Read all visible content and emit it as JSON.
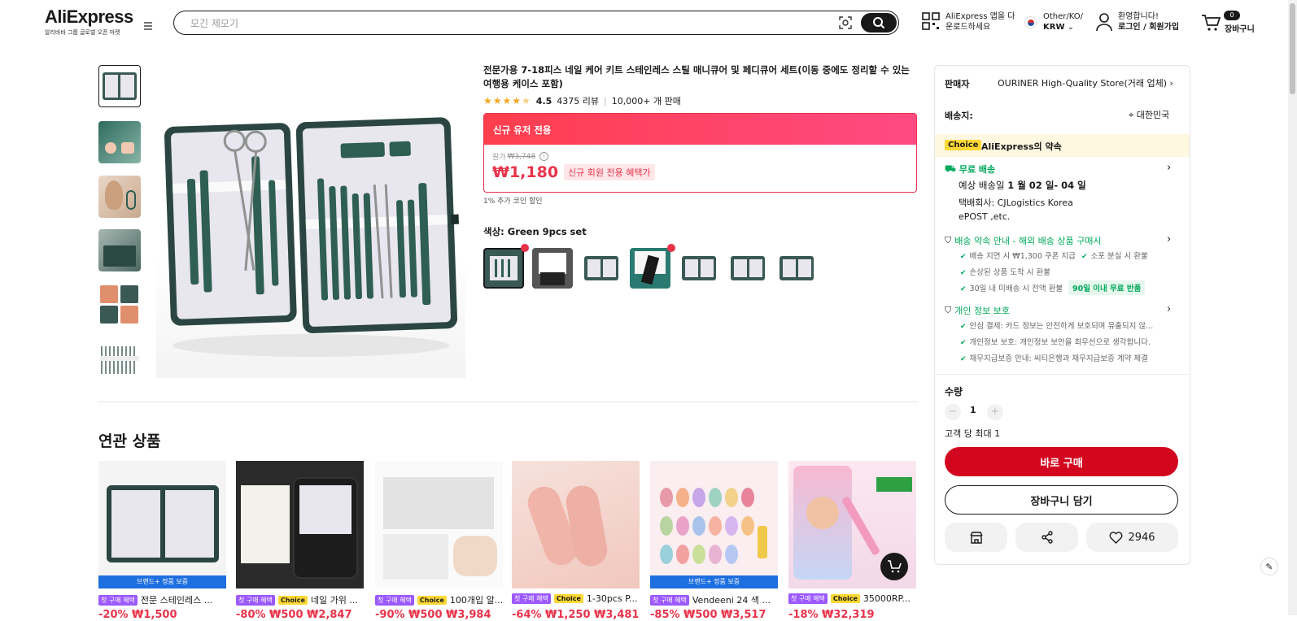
{
  "header": {
    "logo": "AliExpress",
    "logo_sub": "알리바바 그룹 글로벌 오픈 마켓",
    "search_placeholder": "모긴 제모기",
    "app_line1": "AliExpress 앱을 다",
    "app_line2": "운로드하세요",
    "region_line1": "Other/KO/",
    "region_line2": "KRW",
    "account_line1": "환영합니다!",
    "account_line2": "로그인 / 회원가입",
    "cart_count": "0",
    "cart_label": "장바구니"
  },
  "product": {
    "title": "전문가용 7-18피스 네일 케어 키트 스테인레스 스틸 매니큐어 및 페디큐어 세트(이동 중에도 정리할 수 있는 여행용 케이스 포함)",
    "rating": "4.5",
    "reviews": "4375 리뷰",
    "sold": "10,000+ 개 판매",
    "deal_banner": "신규 유저 전용",
    "original_label": "원가",
    "original_price": "₩3,748",
    "price": "₩1,180",
    "new_member_badge": "신규 회원 전용 혜택가",
    "coin_discount": "1% 추가 코인 할인",
    "color_label": "색상: Green 9pcs set",
    "related_title": "연관 상품"
  },
  "panel": {
    "seller_label": "판매자",
    "seller_name": "OURINER High-Quality Store(거래 업체)",
    "ship_to_label": "배송지:",
    "ship_to": "대한민국",
    "choice_badge": "Choice",
    "promise": "AliExpress의 약속",
    "free_shipping": "무료 배송",
    "delivery_prefix": "예상 배송일",
    "delivery_dates": "1 월 02 일- 04 일",
    "courier_line1": "택배회사:  CJLogistics  Korea",
    "courier_line2": "ePOST ,etc.",
    "shipping_guide": "배송 약속 안내 - 해외 배송 상품 구매시",
    "guide_items": [
      "배송 지연 시 ₩1,300 쿠폰 지급",
      "소포 분실 시 환불",
      "손상된 상품 도착 시 환불",
      "30일 내 미배송 시 전액 환불"
    ],
    "free_return": "90일 이내 무료 반품",
    "privacy": "개인 정보 보호",
    "privacy_items": [
      "안심 결제: 카드 정보는 안전하게 보호되며 유출되지 않...",
      "개인정보 보호: 개인정보 보안을 최우선으로 생각합니다.",
      "채무지급보증 안내: 씨티은행과 채무지급보증 계약 체결"
    ],
    "qty_label": "수량",
    "qty": "1",
    "qty_limit": "고객 당 최대 1",
    "buy_now": "바로 구매",
    "add_cart": "장바구니 담기",
    "wishlist_count": "2946"
  },
  "related": [
    {
      "badge": "브랜드+ 정품 보증",
      "title": "전문 스테인레스 ..."
    },
    {
      "choice": "Choice",
      "title": "네일 가위 ..."
    },
    {
      "choice": "Choice",
      "title": "100개입 알..."
    },
    {
      "choice": "Choice",
      "title": "1-30pcs P..."
    },
    {
      "badge": "브랜드+ 정품 보증",
      "title": "Vendeeni 24 색 ..."
    },
    {
      "choice": "Choice",
      "title": "35000RP..."
    }
  ],
  "related_tag": "첫 구매 혜택",
  "related_prices": [
    "-20% ₩1,500",
    "-80% ₩500 ₩2,847",
    "-90% ₩500 ₩3,984",
    "-64% ₩1,250 ₩3,481",
    "-85% ₩500 ₩3,517",
    "-18% ₩32,319"
  ],
  "colors": {
    "accent": "#e8334a",
    "green": "#00a85a",
    "choice": "#fdd835",
    "purple": "#9b59ff"
  }
}
